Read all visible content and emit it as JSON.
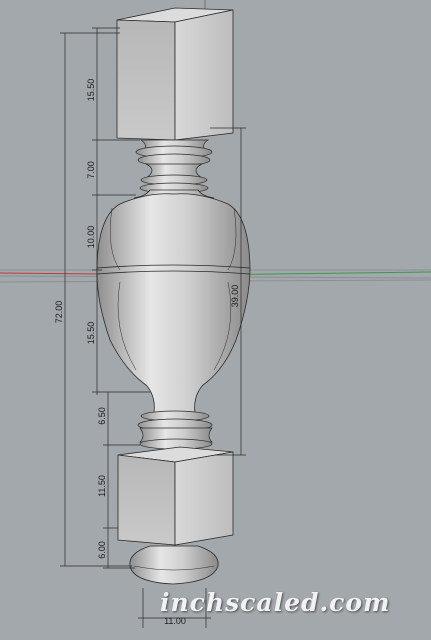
{
  "viewport": {
    "background_color": "#a3a8ad",
    "model_color": "#c9c9c9",
    "dimension_line_color": "#2a2a2a"
  },
  "dimensions": {
    "overall_height": "72.00",
    "body_height": "39.00",
    "top_block": "15.50",
    "upper_collar": "7.00",
    "vase_upper": "10.00",
    "vase_lower": "15.50",
    "lower_collar": "6.50",
    "bottom_block": "11.50",
    "foot": "6.00",
    "foot_width": "11.00"
  },
  "watermark": "inchscaled.com"
}
